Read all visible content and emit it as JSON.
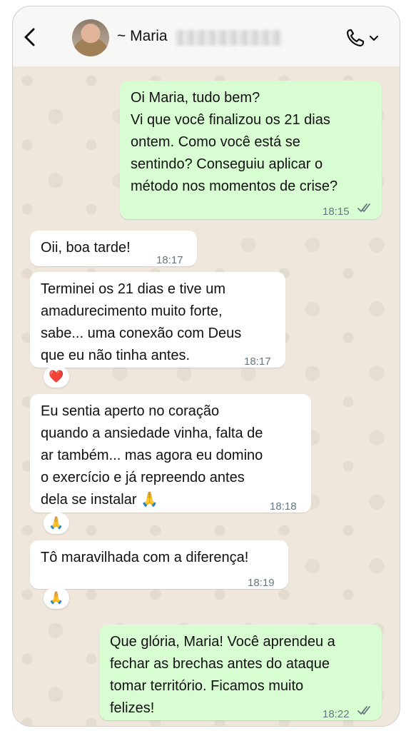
{
  "header": {
    "contact_name": "~ Maria"
  },
  "messages": [
    {
      "text": "Oi Maria, tudo bem?\nVi que você finalizou os 21 dias\nontem. Como você está se\nsentindo? Conseguiu aplicar o\nmétodo nos momentos de crise?",
      "time": "18:15"
    },
    {
      "text": "Oii, boa tarde!",
      "time": "18:17"
    },
    {
      "text": "Terminei os 21 dias e tive um\namadurecimento muito forte,\nsabe... uma conexão com Deus\nque eu não tinha antes.",
      "time": "18:17",
      "reaction": "❤️"
    },
    {
      "text": "Eu sentia aperto no coração\nquando a ansiedade vinha, falta de\nar também... mas agora eu domino\no exercício e já repreendo antes\ndela se instalar 🙏",
      "time": "18:18",
      "reaction": "🙏"
    },
    {
      "text": "Tô maravilhada com a diferença!",
      "time": "18:19",
      "reaction": "🙏"
    },
    {
      "text": "Que glória, Maria! Você aprendeu a\nfechar as brechas antes do ataque\ntomar território. Ficamos muito\nfelizes!",
      "time": "18:22"
    }
  ],
  "colors": {
    "outgoing_bubble": "#d9fdd3",
    "incoming_bubble": "#ffffff",
    "read_receipt": "#667781",
    "chat_background": "#efe7dc"
  },
  "icons": [
    "back-arrow-icon",
    "phone-icon",
    "chevron-down-icon",
    "double-check-icon"
  ]
}
